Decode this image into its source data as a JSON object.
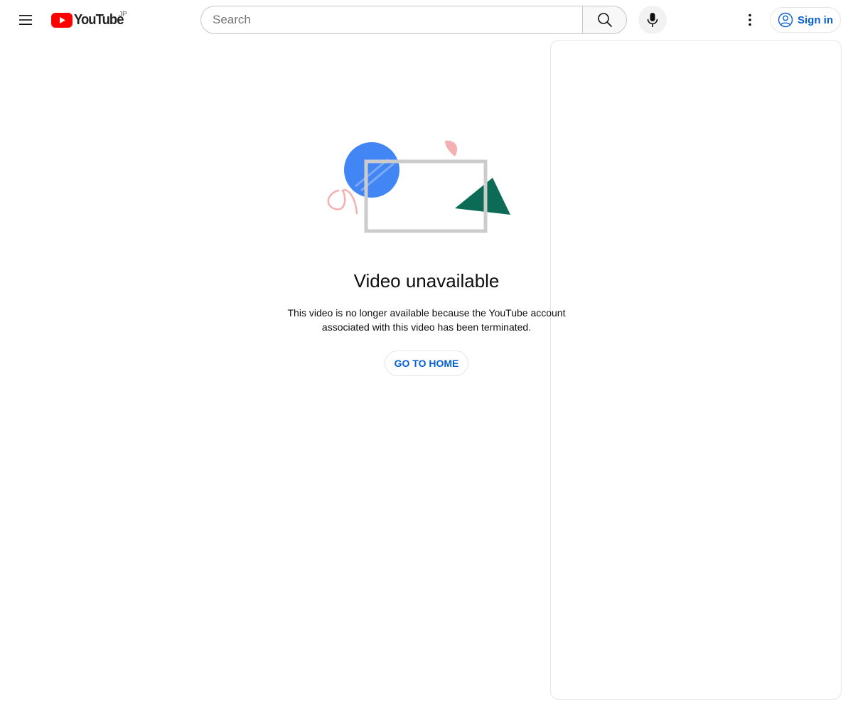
{
  "masthead": {
    "logo_text": "YouTube",
    "country_code": "JP",
    "search": {
      "placeholder": "Search",
      "value": ""
    },
    "signin_label": "Sign in",
    "icons": {
      "menu": "hamburger-menu-icon",
      "search": "search-icon",
      "mic": "microphone-icon",
      "more": "more-vertical-icon",
      "account": "account-circle-icon"
    }
  },
  "error": {
    "title": "Video unavailable",
    "message": "This video is no longer available because the YouTube account associated with this video has been terminated.",
    "home_button": "GO TO HOME"
  },
  "colors": {
    "brand_red": "#ff0000",
    "link_blue": "#065fd4",
    "illustration_blue": "#4285f4",
    "illustration_green": "#0b6b55",
    "illustration_pink": "#f4b0b0",
    "frame_gray": "#cccccc"
  }
}
